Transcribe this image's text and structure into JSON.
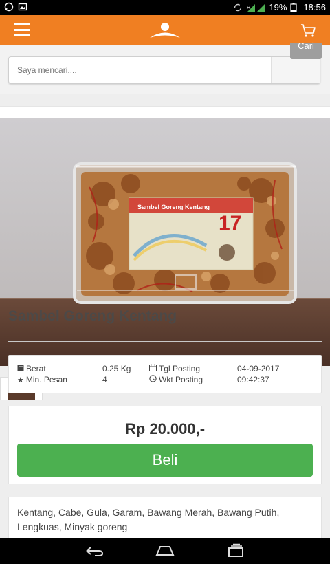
{
  "status_bar": {
    "battery_percent": "19%",
    "time": "18:56",
    "icons": [
      "whatsapp-icon",
      "image-icon",
      "sync-icon",
      "signal-icon",
      "battery-icon"
    ]
  },
  "app_bar": {
    "menu_icon": "menu-icon",
    "logo_icon": "logo-icon",
    "cart_icon": "cart-icon",
    "search_button_label": "Cari",
    "brand_color": "#f07f22"
  },
  "search": {
    "placeholder": "Saya mencari...."
  },
  "product": {
    "title": "Sambel Goreng Kentang",
    "details": {
      "weight_label": "Berat",
      "weight_value": "0.25 Kg",
      "min_order_label": "Min. Pesan",
      "min_order_value": "4",
      "post_date_label": "Tgl Posting",
      "post_date_value": "04-09-2017",
      "post_time_label": "Wkt Posting",
      "post_time_value": "09:42:37"
    },
    "price": "Rp 20.000,-",
    "buy_label": "Beli",
    "buy_color": "#4cb050",
    "description": "Kentang, Cabe, Gula, Garam, Bawang Merah, Bawang Putih, Lengkuas, Minyak goreng"
  },
  "product_package": {
    "label_text": "Sambel Goreng Kentang",
    "label_number": "17"
  },
  "nav_bar": {
    "icons": [
      "back-icon",
      "home-icon",
      "recents-icon"
    ]
  }
}
